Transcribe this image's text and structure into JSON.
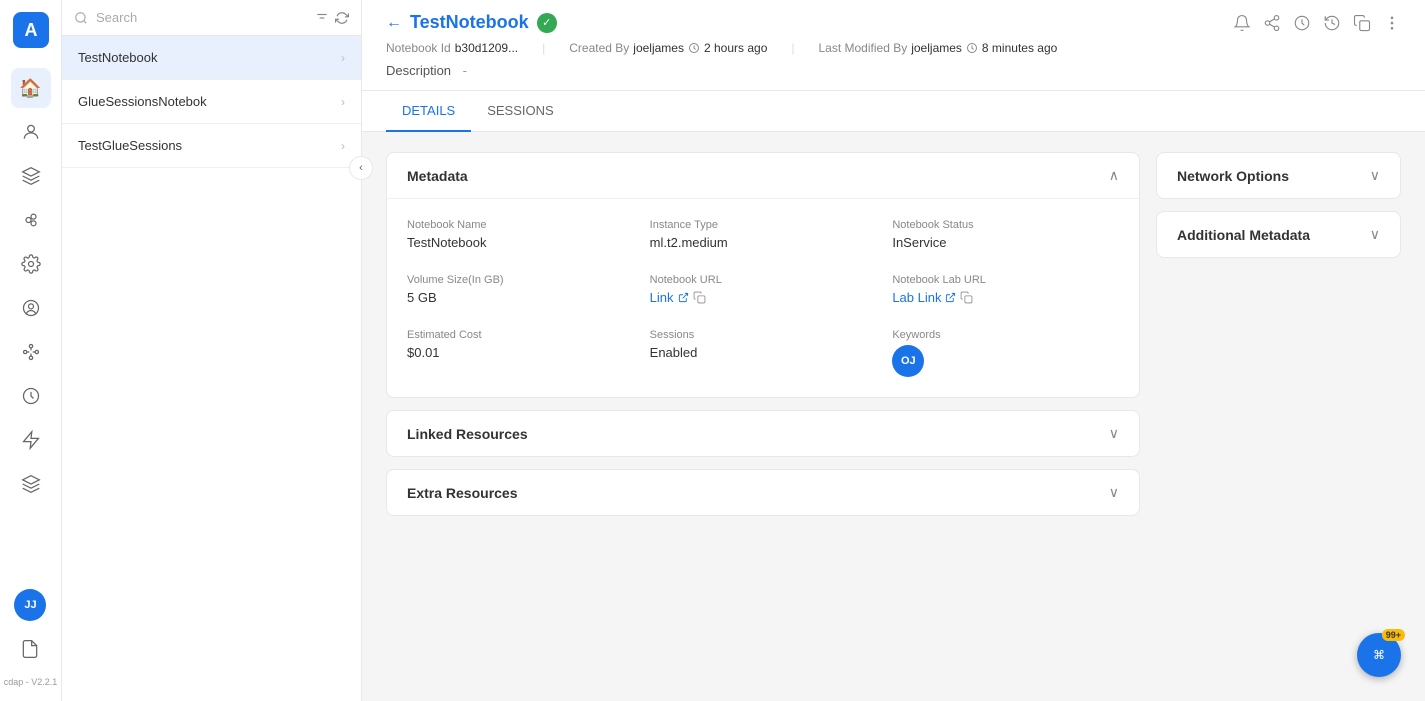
{
  "app": {
    "logo_text": "A",
    "version": "cdap - V2.2.1"
  },
  "nav_icons": [
    {
      "name": "home-icon",
      "symbol": "⌂"
    },
    {
      "name": "person-icon",
      "symbol": "👤"
    },
    {
      "name": "data-icon",
      "symbol": "⚗"
    },
    {
      "name": "group-icon",
      "symbol": "⬡"
    },
    {
      "name": "settings-icon",
      "symbol": "⚙"
    },
    {
      "name": "user-circle-icon",
      "symbol": "◎"
    },
    {
      "name": "workflow-icon",
      "symbol": "⟳"
    },
    {
      "name": "clock-icon",
      "symbol": "⏱"
    },
    {
      "name": "bolt-icon",
      "symbol": "⚡"
    },
    {
      "name": "layers-icon",
      "symbol": "≋"
    }
  ],
  "sidebar": {
    "search_placeholder": "Search",
    "notebooks": [
      {
        "id": "testnotebook",
        "label": "TestNotebook",
        "active": true
      },
      {
        "id": "glue",
        "label": "GlueSessionsNotebok",
        "active": false
      },
      {
        "id": "testglue",
        "label": "TestGlueSessions",
        "active": false
      }
    ]
  },
  "header": {
    "back_label": "←",
    "title": "TestNotebook",
    "status_icon": "✓",
    "notebook_id_label": "Notebook Id",
    "notebook_id_value": "b30d1209...",
    "created_by_label": "Created By",
    "created_by_value": "joeljames",
    "created_time": "2 hours ago",
    "modified_by_label": "Last Modified By",
    "modified_by_value": "joeljames",
    "modified_time": "8 minutes ago",
    "description_label": "Description",
    "description_value": "-"
  },
  "tabs": [
    {
      "id": "details",
      "label": "DETAILS",
      "active": true
    },
    {
      "id": "sessions",
      "label": "SESSIONS",
      "active": false
    }
  ],
  "metadata_section": {
    "title": "Metadata",
    "fields": [
      {
        "label": "Notebook Name",
        "value": "TestNotebook",
        "type": "text"
      },
      {
        "label": "Instance Type",
        "value": "ml.t2.medium",
        "type": "text"
      },
      {
        "label": "Notebook Status",
        "value": "InService",
        "type": "text"
      },
      {
        "label": "Volume Size(In GB)",
        "value": "5 GB",
        "type": "text"
      },
      {
        "label": "Notebook URL",
        "link_text": "Link",
        "type": "link"
      },
      {
        "label": "Notebook Lab URL",
        "link_text": "Lab Link",
        "type": "link"
      },
      {
        "label": "Estimated Cost",
        "value": "$0.01",
        "type": "text"
      },
      {
        "label": "Sessions",
        "value": "Enabled",
        "type": "text"
      },
      {
        "label": "Keywords",
        "avatar": "OJ",
        "type": "avatar"
      }
    ]
  },
  "linked_resources": {
    "title": "Linked Resources"
  },
  "extra_resources": {
    "title": "Extra Resources"
  },
  "network_options": {
    "title": "Network Options"
  },
  "additional_metadata": {
    "title": "Additional Metadata"
  },
  "notification": {
    "badge": "99+",
    "icon": "⌘"
  },
  "avatar": {
    "initials": "JJ"
  }
}
